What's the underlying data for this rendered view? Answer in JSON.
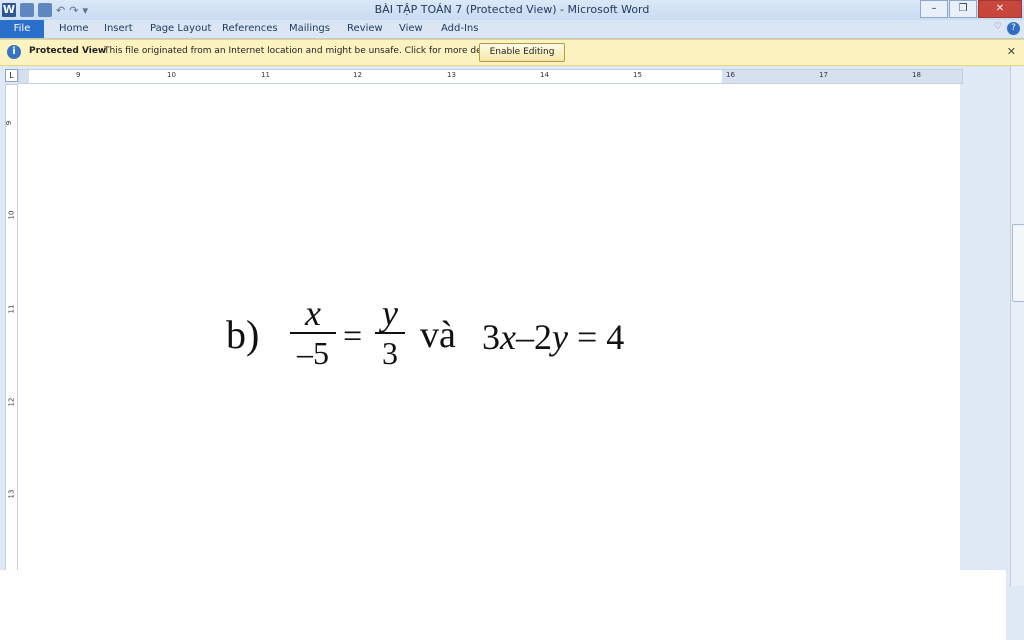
{
  "window": {
    "title": "BÀI TẬP TOÁN 7 (Protected View)  -  Microsoft Word"
  },
  "quick_access": {
    "app_icon": "W",
    "undo_label": "↶",
    "redo_label": "↷",
    "customize_label": "▾"
  },
  "ribbon": {
    "file_label": "File",
    "tabs": [
      "Home",
      "Insert",
      "Page Layout",
      "References",
      "Mailings",
      "Review",
      "View",
      "Add-Ins"
    ]
  },
  "protected_view": {
    "label": "Protected View",
    "message": "This file originated from an Internet location and might be unsafe. Click for more details.",
    "button_label": "Enable Editing"
  },
  "ruler": {
    "horizontal_numbers": [
      "9",
      "10",
      "11",
      "12",
      "13",
      "14",
      "15",
      "16",
      "17",
      "18"
    ],
    "vertical_numbers": [
      "9",
      "10",
      "11",
      "12",
      "13"
    ]
  },
  "document": {
    "label": "b)",
    "frac1_num": "x",
    "frac1_den": "–5",
    "equals1": "=",
    "frac2_num": "y",
    "frac2_den": "3",
    "conj": "và",
    "eq_part1": "3",
    "eq_var1": "x",
    "eq_minus": "–",
    "eq_part2": "2",
    "eq_var2": "y",
    "eq_tail": "= 4"
  }
}
